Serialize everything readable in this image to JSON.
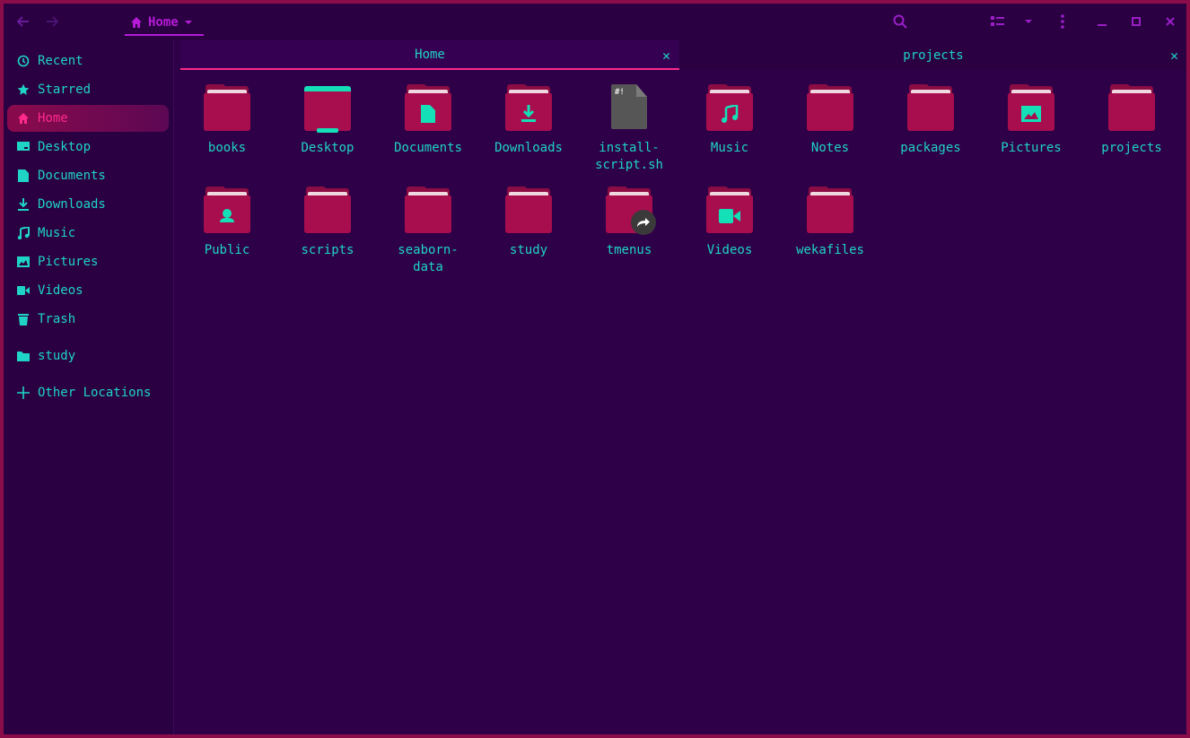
{
  "window": {
    "path_button_label": "Home"
  },
  "sidebar": {
    "items": [
      {
        "label": "Recent",
        "icon": "clock-icon"
      },
      {
        "label": "Starred",
        "icon": "star-icon"
      },
      {
        "label": "Home",
        "icon": "home-icon",
        "active": true
      },
      {
        "label": "Desktop",
        "icon": "desktop-icon"
      },
      {
        "label": "Documents",
        "icon": "document-icon"
      },
      {
        "label": "Downloads",
        "icon": "download-icon"
      },
      {
        "label": "Music",
        "icon": "music-icon"
      },
      {
        "label": "Pictures",
        "icon": "picture-icon"
      },
      {
        "label": "Videos",
        "icon": "video-icon"
      },
      {
        "label": "Trash",
        "icon": "trash-icon"
      },
      {
        "label": "study",
        "icon": "folder-icon"
      },
      {
        "label": "Other Locations",
        "icon": "plus-icon"
      }
    ]
  },
  "tabs": [
    {
      "label": "Home",
      "active": true
    },
    {
      "label": "projects",
      "active": false
    }
  ],
  "files": [
    {
      "line1": "books",
      "line2": "",
      "kind": "folder"
    },
    {
      "line1": "Desktop",
      "line2": "",
      "kind": "desktop"
    },
    {
      "line1": "Documents",
      "line2": "",
      "kind": "folder-documents"
    },
    {
      "line1": "Downloads",
      "line2": "",
      "kind": "folder-downloads"
    },
    {
      "line1": "install-",
      "line2": "script.sh",
      "kind": "script-file"
    },
    {
      "line1": "Music",
      "line2": "",
      "kind": "folder-music"
    },
    {
      "line1": "Notes",
      "line2": "",
      "kind": "folder"
    },
    {
      "line1": "packages",
      "line2": "",
      "kind": "folder"
    },
    {
      "line1": "Pictures",
      "line2": "",
      "kind": "folder-pictures"
    },
    {
      "line1": "projects",
      "line2": "",
      "kind": "folder"
    },
    {
      "line1": "Public",
      "line2": "",
      "kind": "folder-public"
    },
    {
      "line1": "scripts",
      "line2": "",
      "kind": "folder"
    },
    {
      "line1": "seaborn-",
      "line2": "data",
      "kind": "folder"
    },
    {
      "line1": "study",
      "line2": "",
      "kind": "folder"
    },
    {
      "line1": "tmenus",
      "line2": "",
      "kind": "folder-link"
    },
    {
      "line1": "Videos",
      "line2": "",
      "kind": "folder-videos"
    },
    {
      "line1": "wekafiles",
      "line2": "",
      "kind": "folder"
    }
  ],
  "file_shebang": "#!",
  "colors": {
    "accent_pink": "#ff2a8a",
    "accent_purple": "#b51bd6",
    "text_cyan": "#1fd4c4",
    "folder": "#a80e4e",
    "background": "#2e0048"
  }
}
